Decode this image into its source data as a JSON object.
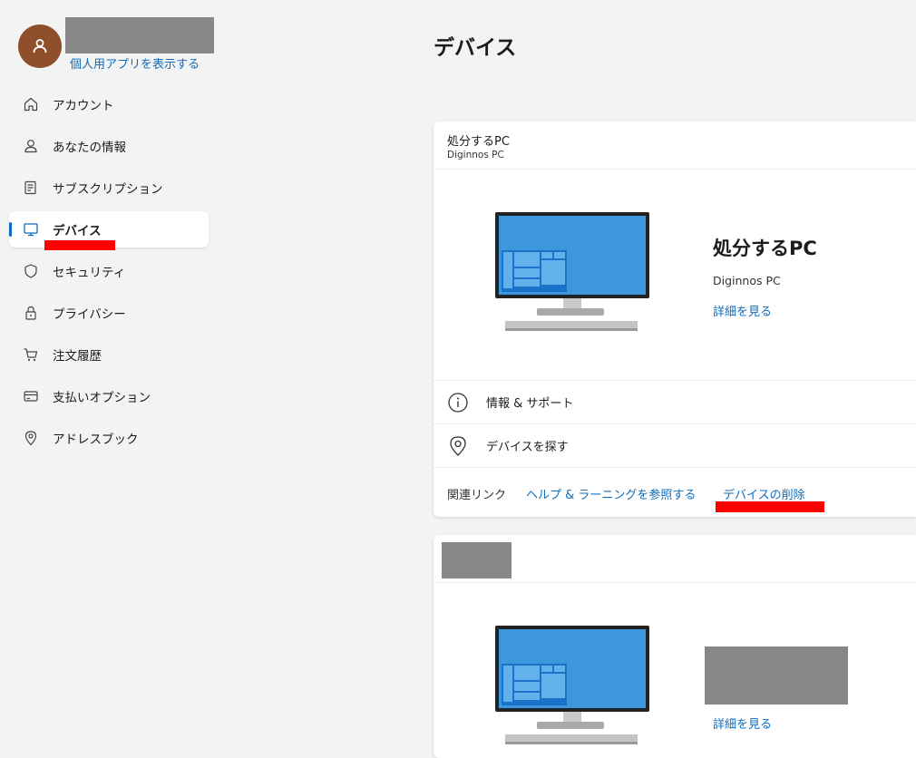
{
  "sidebar": {
    "show_apps_link": "個人用アプリを表示する",
    "items": [
      {
        "label": "アカウント",
        "icon": "home-icon"
      },
      {
        "label": "あなたの情報",
        "icon": "person-icon"
      },
      {
        "label": "サブスクリプション",
        "icon": "subscription-icon"
      },
      {
        "label": "デバイス",
        "icon": "monitor-icon",
        "active": true
      },
      {
        "label": "セキュリティ",
        "icon": "shield-icon"
      },
      {
        "label": "プライバシー",
        "icon": "lock-icon"
      },
      {
        "label": "注文履歴",
        "icon": "cart-icon"
      },
      {
        "label": "支払いオプション",
        "icon": "card-icon"
      },
      {
        "label": "アドレスブック",
        "icon": "location-icon"
      }
    ]
  },
  "main": {
    "title": "デバイス",
    "device1": {
      "header_name": "処分するPC",
      "header_model": "Diginnos PC",
      "name": "処分するPC",
      "model": "Diginnos PC",
      "details_link": "詳細を見る",
      "rows": [
        {
          "label": "情報 & サポート",
          "icon": "info-icon"
        },
        {
          "label": "デバイスを探す",
          "icon": "location-icon"
        }
      ],
      "related_label": "関連リンク",
      "related_links": [
        "ヘルプ & ラーニングを参照する",
        "デバイスの削除"
      ]
    },
    "device2": {
      "details_link": "詳細を見る"
    }
  },
  "colors": {
    "accent": "#0f6cbd",
    "avatar": "#8e4f2a",
    "highlight": "#ff0000",
    "redaction": "#878787"
  }
}
